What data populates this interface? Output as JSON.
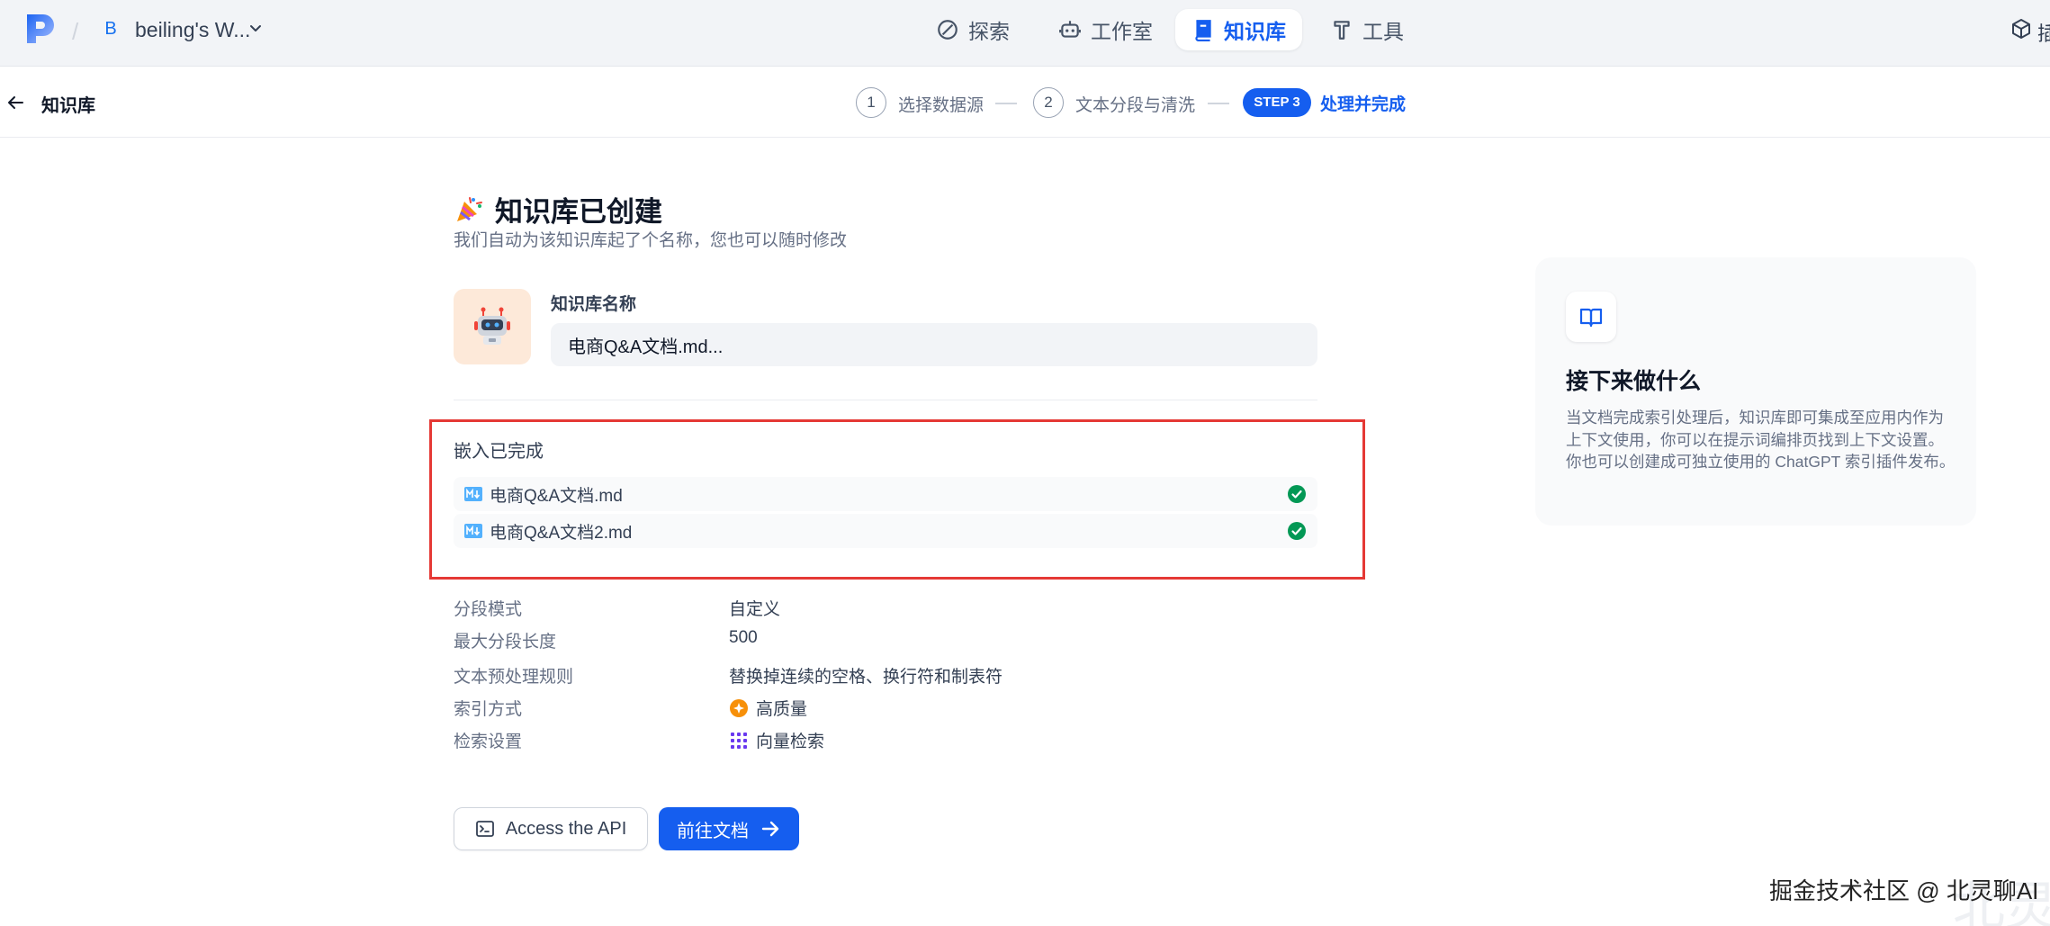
{
  "topbar": {
    "workspace_initial": "B",
    "workspace_name": "beiling's W...",
    "nav": {
      "explore": "探索",
      "studio": "工作室",
      "knowledge": "知识库",
      "tools": "工具"
    },
    "right_partial": "插"
  },
  "subheader": {
    "title": "知识库",
    "steps": [
      {
        "num": "1",
        "label": "选择数据源"
      },
      {
        "num": "2",
        "label": "文本分段与清洗"
      },
      {
        "num": "STEP 3",
        "label": "处理并完成"
      }
    ]
  },
  "main": {
    "title": "知识库已创建",
    "subtitle": "我们自动为该知识库起了个名称，您也可以随时修改",
    "name_label": "知识库名称",
    "name_value": "电商Q&A文档.md...",
    "embed_title": "嵌入已完成",
    "files": [
      "电商Q&A文档.md",
      "电商Q&A文档2.md"
    ],
    "info": [
      {
        "label": "分段模式",
        "value": "自定义"
      },
      {
        "label": "最大分段长度",
        "value": "500"
      },
      {
        "label": "文本预处理规则",
        "value": "替换掉连续的空格、换行符和制表符"
      },
      {
        "label": "索引方式",
        "value": "高质量"
      },
      {
        "label": "检索设置",
        "value": "向量检索"
      }
    ],
    "api_button": "Access the API",
    "docs_button": "前往文档"
  },
  "side_panel": {
    "title": "接下来做什么",
    "description": "当文档完成索引处理后，知识库即可集成至应用内作为上下文使用，你可以在提示词编排页找到上下文设置。你也可以创建成可独立使用的 ChatGPT 索引插件发布。"
  },
  "watermark": "掘金技术社区 @ 北灵聊AI",
  "watermark_bg": "北灵",
  "colors": {
    "primary": "#155eef",
    "success": "#12b76a",
    "highlight_box": "#e53935"
  }
}
